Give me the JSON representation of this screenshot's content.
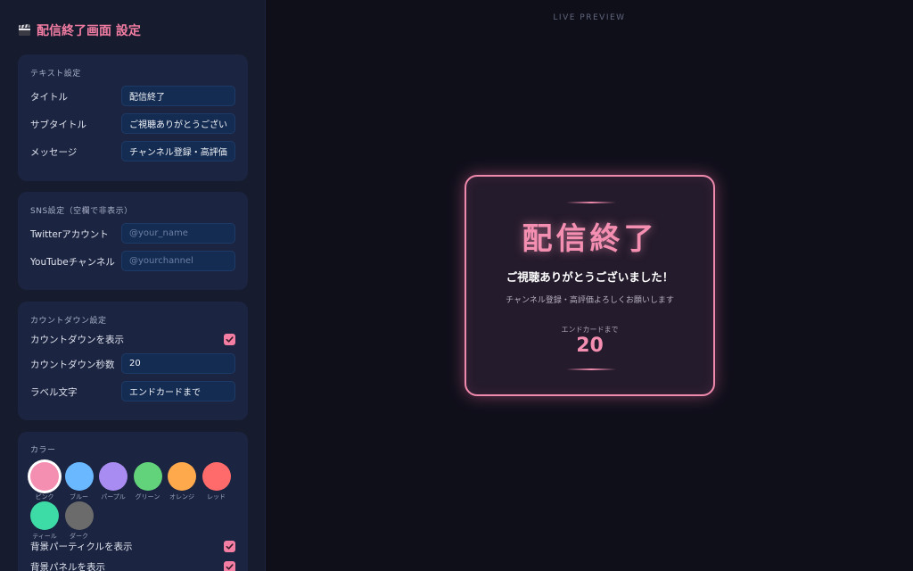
{
  "sidebar": {
    "title": "配信終了画面 設定",
    "text_panel": {
      "heading": "テキスト設定",
      "title_label": "タイトル",
      "title_value": "配信終了",
      "subtitle_label": "サブタイトル",
      "subtitle_value": "ご視聴ありがとうございました！",
      "message_label": "メッセージ",
      "message_value": "チャンネル登録・高評価よろしくお願いします"
    },
    "sns_panel": {
      "heading": "SNS設定（空欄で非表示）",
      "twitter_label": "Twitterアカウント",
      "twitter_placeholder": "@your_name",
      "youtube_label": "YouTubeチャンネル",
      "youtube_placeholder": "@yourchannel"
    },
    "countdown_panel": {
      "heading": "カウントダウン設定",
      "show_label": "カウントダウンを表示",
      "show_checked": true,
      "seconds_label": "カウントダウン秒数",
      "seconds_value": "20",
      "text_label": "ラベル文字",
      "text_value": "エンドカードまで"
    },
    "color_panel": {
      "heading": "カラー",
      "swatches": [
        {
          "label": "ピンク",
          "color": "#f48fb1",
          "selected": true
        },
        {
          "label": "ブルー",
          "color": "#6ab8ff",
          "selected": false
        },
        {
          "label": "パープル",
          "color": "#a98cf2",
          "selected": false
        },
        {
          "label": "グリーン",
          "color": "#62d37a",
          "selected": false
        },
        {
          "label": "オレンジ",
          "color": "#ffa94d",
          "selected": false
        },
        {
          "label": "レッド",
          "color": "#ff6b6b",
          "selected": false
        },
        {
          "label": "ティール",
          "color": "#3ddba5",
          "selected": false
        },
        {
          "label": "ダーク",
          "color": "#6b6b6b",
          "selected": false
        }
      ],
      "particles_label": "背景パーティクルを表示",
      "particles_checked": true,
      "panel_label": "背景パネルを表示",
      "panel_checked": true
    }
  },
  "preview": {
    "label": "LIVE PREVIEW",
    "title": "配信終了",
    "subtitle": "ご視聴ありがとうございました！",
    "message": "チャンネル登録・高評価よろしくお願いします",
    "countdown_label": "エンドカードまで",
    "countdown_value": "20"
  },
  "colors": {
    "accent": "#f48fb1",
    "sidebar_bg": "#161b2e",
    "panel_bg": "#1b2440",
    "field_bg": "#142c52",
    "canvas_bg": "#0f0f1a"
  }
}
